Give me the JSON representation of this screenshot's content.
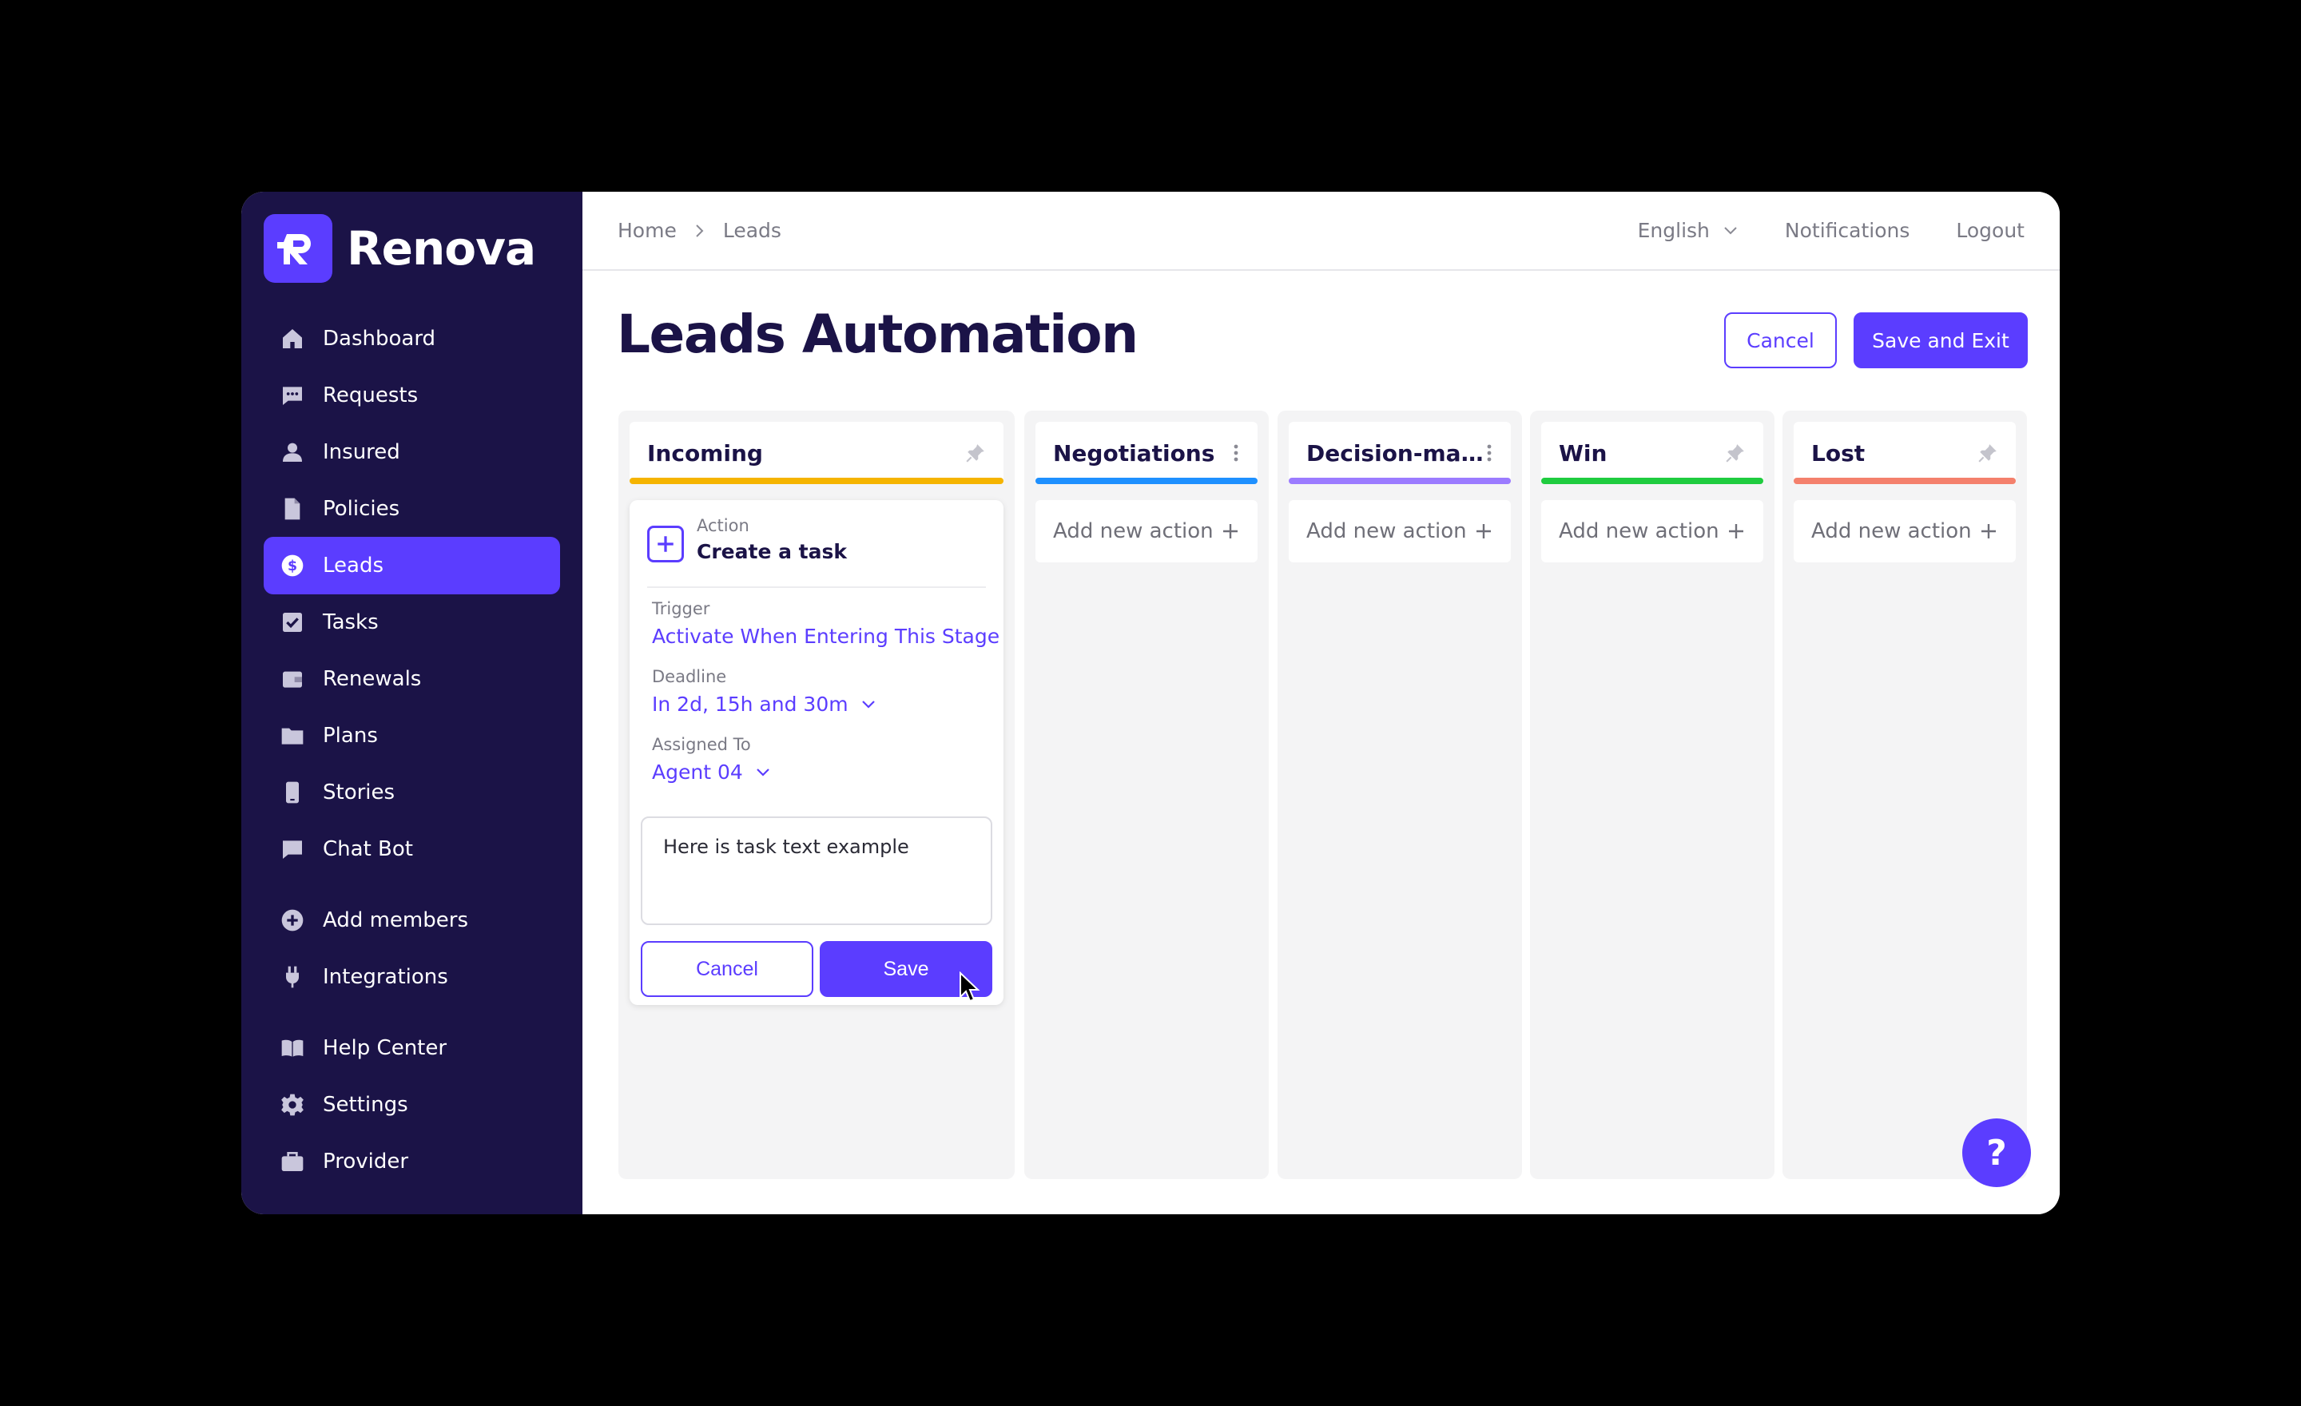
{
  "brand": {
    "name": "Renova",
    "accent": "#5b3dff",
    "sidebar_bg": "#1b1347"
  },
  "sidebar": {
    "items": [
      {
        "label": "Dashboard",
        "icon": "home-icon"
      },
      {
        "label": "Requests",
        "icon": "chat-icon"
      },
      {
        "label": "Insured",
        "icon": "user-icon"
      },
      {
        "label": "Policies",
        "icon": "file-icon"
      },
      {
        "label": "Leads",
        "icon": "dollar-icon",
        "active": true
      },
      {
        "label": "Tasks",
        "icon": "checkbox-icon"
      },
      {
        "label": "Renewals",
        "icon": "wallet-icon"
      },
      {
        "label": "Plans",
        "icon": "folder-icon"
      },
      {
        "label": "Stories",
        "icon": "phone-icon"
      },
      {
        "label": "Chat Bot",
        "icon": "message-icon"
      },
      {
        "label": "Add members",
        "icon": "plus-circle-icon"
      },
      {
        "label": "Integrations",
        "icon": "plug-icon"
      },
      {
        "label": "Help Center",
        "icon": "book-icon"
      },
      {
        "label": "Settings",
        "icon": "gear-icon"
      },
      {
        "label": "Provider",
        "icon": "briefcase-icon"
      }
    ]
  },
  "topbar": {
    "breadcrumb": [
      "Home",
      "Leads"
    ],
    "language": "English",
    "notifications": "Notifications",
    "logout": "Logout"
  },
  "page": {
    "title": "Leads Automation",
    "cancel_label": "Cancel",
    "save_exit_label": "Save and Exit"
  },
  "columns": [
    {
      "title": "Incoming",
      "color": "#f5b400",
      "icon": "pin-icon"
    },
    {
      "title": "Negotiations",
      "color": "#1e90ff",
      "icon": "more-vertical-icon"
    },
    {
      "title": "Decision-ma...",
      "color": "#9b7bff",
      "icon": "more-vertical-icon"
    },
    {
      "title": "Win",
      "color": "#1fcc3f",
      "icon": "pin-icon"
    },
    {
      "title": "Lost",
      "color": "#f4806c",
      "icon": "pin-icon"
    }
  ],
  "add_action_label": "Add new action",
  "task_card": {
    "type_label": "Action",
    "title": "Create a task",
    "trigger_label": "Trigger",
    "trigger_value": "Activate When Entering This Stage",
    "deadline_label": "Deadline",
    "deadline_value": "In 2d, 15h and 30m",
    "assigned_label": "Assigned To",
    "assigned_value": "Agent 04",
    "text": "Here is task text example",
    "cancel_label": "Cancel",
    "save_label": "Save"
  },
  "help_label": "?"
}
